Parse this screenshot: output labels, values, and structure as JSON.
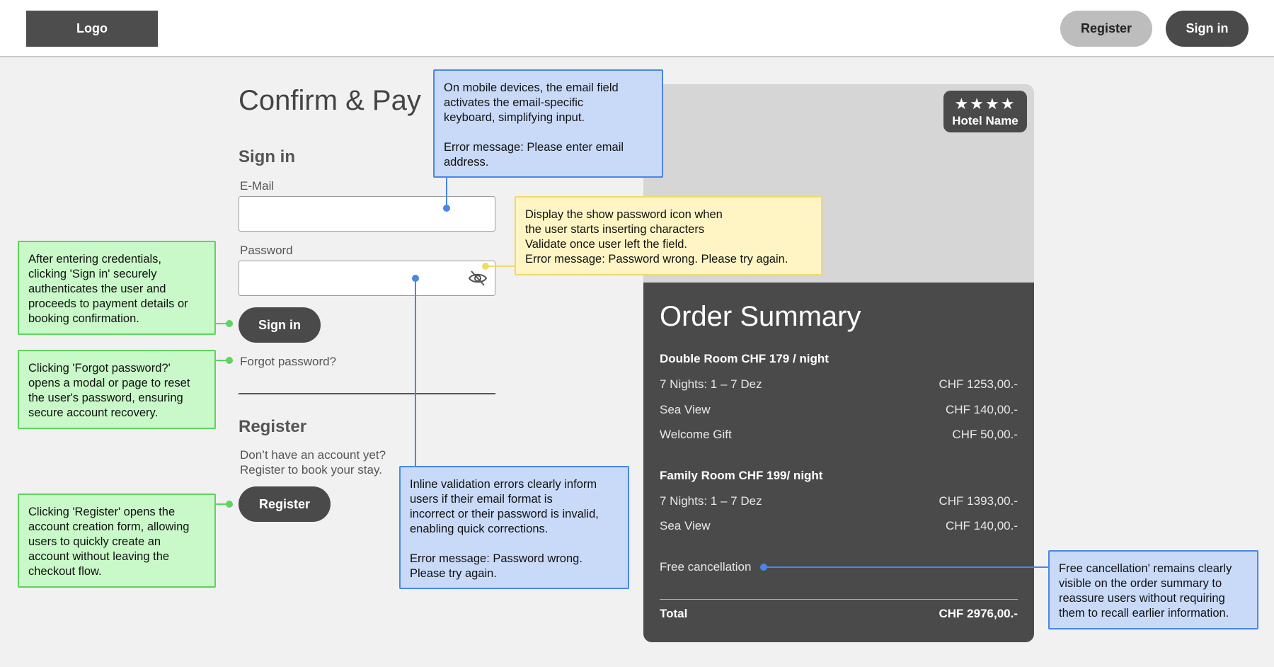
{
  "header": {
    "logo": "Logo",
    "register_label": "Register",
    "signin_label": "Sign in"
  },
  "form": {
    "title": "Confirm & Pay",
    "signin_heading": "Sign in",
    "email_label": "E-Mail",
    "email_value": "",
    "password_label": "Password",
    "password_value": "",
    "signin_button": "Sign in",
    "forgot_link": "Forgot password?",
    "register_heading": "Register",
    "register_text_line1": "Don’t have an account yet?",
    "register_text_line2": "Register to book your stay.",
    "register_button": "Register",
    "password_icon": "eye-slash-icon"
  },
  "hotel": {
    "stars": "★★★★",
    "star_count": 4,
    "name": "Hotel Name"
  },
  "order": {
    "title": "Order Summary",
    "room1": {
      "heading": "Double Room CHF 179 / night",
      "items": [
        {
          "label": "7 Nights: 1 – 7 Dez",
          "price": "CHF 1253,00.-"
        },
        {
          "label": "Sea View",
          "price": "CHF 140,00.-"
        },
        {
          "label": "Welcome Gift",
          "price": "CHF 50,00.-"
        }
      ]
    },
    "room2": {
      "heading": "Family Room CHF 199/ night",
      "items": [
        {
          "label": "7 Nights: 1 – 7 Dez",
          "price": "CHF 1393,00.-"
        },
        {
          "label": "Sea View",
          "price": "CHF 140,00.-"
        }
      ]
    },
    "cancellation": "Free cancellation",
    "total_label": "Total",
    "total_value": "CHF 2976,00.-"
  },
  "annotations": {
    "email_note": "On mobile devices, the email field\nactivates the email-specific\nkeyboard, simplifying input.\n\nError message: Please enter email\naddress.",
    "password_note": "Display the show password icon when\nthe user starts inserting characters\nValidate once user left the field.\nError message: Password wrong. Please try again.",
    "signin_note": "After entering credentials,\nclicking 'Sign in' securely\nauthenticates the user and\nproceeds to payment details or\nbooking confirmation.",
    "forgot_note": "Clicking 'Forgot password?'\nopens a modal or page to reset\nthe user's password, ensuring\nsecure account recovery.",
    "register_note": "Clicking 'Register' opens the\naccount creation form, allowing\nusers to quickly create an\naccount without leaving the\ncheckout flow.",
    "validation_note": "Inline validation errors clearly inform\nusers if their email format is\nincorrect or their password is invalid,\nenabling quick corrections.\n\nError message: Password wrong.\nPlease try again.",
    "cancellation_note": "Free cancellation' remains clearly\nvisible on the order summary to\nreassure users without requiring\nthem to recall earlier information."
  },
  "colors": {
    "dark": "#4a4a4a",
    "note_blue": "#c9daf8",
    "note_blue_border": "#4a86e8",
    "note_yellow": "#fff5c4",
    "note_green": "#c9f8c9",
    "note_green_border": "#5fd35f"
  }
}
